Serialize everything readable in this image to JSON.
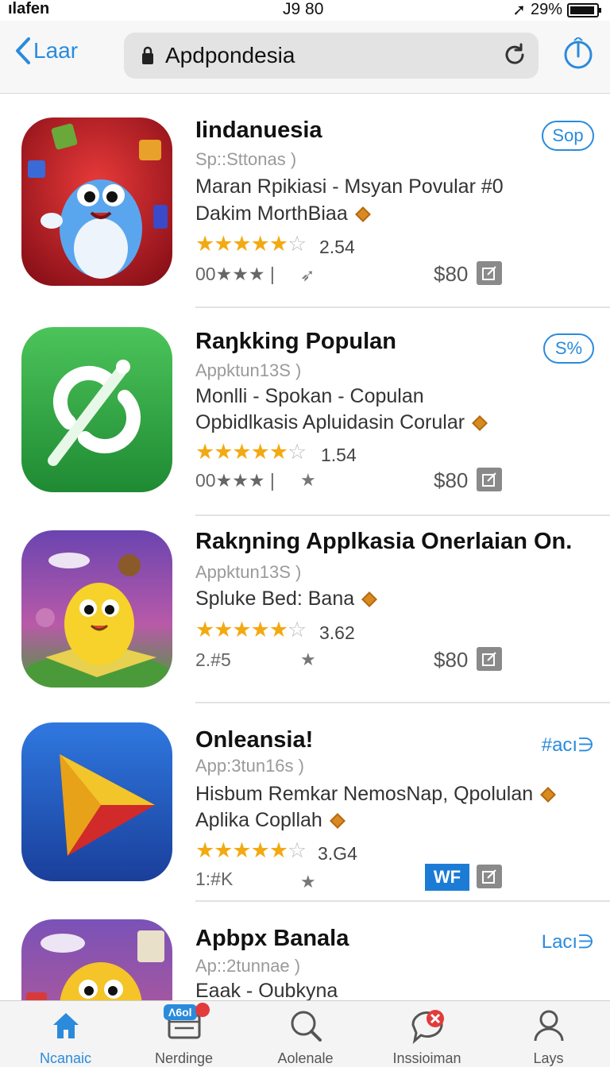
{
  "status": {
    "carrier": "ılafen",
    "time": "J9 80",
    "battery": "29%"
  },
  "nav": {
    "back_label": "Laar",
    "url": "Apdpondesia"
  },
  "apps": [
    {
      "title": "Iindanuesia",
      "subtitle": "Sp::Sttonas  )",
      "desc_line1": "Maran Rpikiasi - Msyan Povular #0",
      "desc_line2": "Dakim MorthBiaa",
      "stars_filled": "★★★★★",
      "stars_empty": "☆",
      "rating": "2.54",
      "count": "00★★★ |",
      "price": "$80",
      "action": "Sop",
      "icon_colors": [
        "#d0202a",
        "#8a1018"
      ]
    },
    {
      "title": "Raŋkking Populan",
      "subtitle": "Appktun13S  )",
      "desc_line1": "Monlli - Spokan - Copulan",
      "desc_line2": "Opbidlkasis Apluidasin Corular",
      "stars_filled": "★★★★★",
      "stars_empty": "☆",
      "rating": "1.54",
      "count": "00★★★ |",
      "price": "$80",
      "action": "S%",
      "icon_colors": [
        "#3fb54a",
        "#1f8a33"
      ]
    },
    {
      "title": "Rakŋning Applkasia Onerlaian On.",
      "subtitle": "Appktun13S  )",
      "desc_line1": "Spluke Bed: Bana",
      "stars_filled": "★★★★★",
      "stars_empty": "☆",
      "rating": "3.62",
      "count": "2.#5",
      "price": "$80",
      "icon_colors": [
        "#7a4fb8",
        "#3f8a3a"
      ]
    },
    {
      "title": "Onleansia!",
      "subtitle": "App:3tun16s  )",
      "desc_line1": "Hisbum Remkar NemosNap,  Qpolulan",
      "desc_line2": "Aplika Copllah",
      "stars_filled": "★★★★★",
      "stars_empty": "☆",
      "rating": "3.G4",
      "count": "1:#K",
      "action": "#acı∋",
      "badge": "WF",
      "icon_colors": [
        "#2a6ad8",
        "#1a3f9a"
      ]
    },
    {
      "title": "Apbpx Banala",
      "subtitle": "Ap::2tunnae  )",
      "desc_line1": "Eaak - Oubkyna",
      "action": "Lacı∋",
      "icon_colors": [
        "#7a5ab8",
        "#e8c23a"
      ]
    }
  ],
  "tabs": [
    {
      "label": "Ncanaic",
      "icon": "home-icon"
    },
    {
      "label": "Nerdinge",
      "icon": "inbox-icon",
      "badge": "Λ6ol"
    },
    {
      "label": "Aolenale",
      "icon": "search-icon"
    },
    {
      "label": "Inssioiman",
      "icon": "chat-icon"
    },
    {
      "label": "Lays",
      "icon": "person-icon"
    }
  ],
  "colors": {
    "accent": "#2a8bdd",
    "star": "#f3a911"
  }
}
